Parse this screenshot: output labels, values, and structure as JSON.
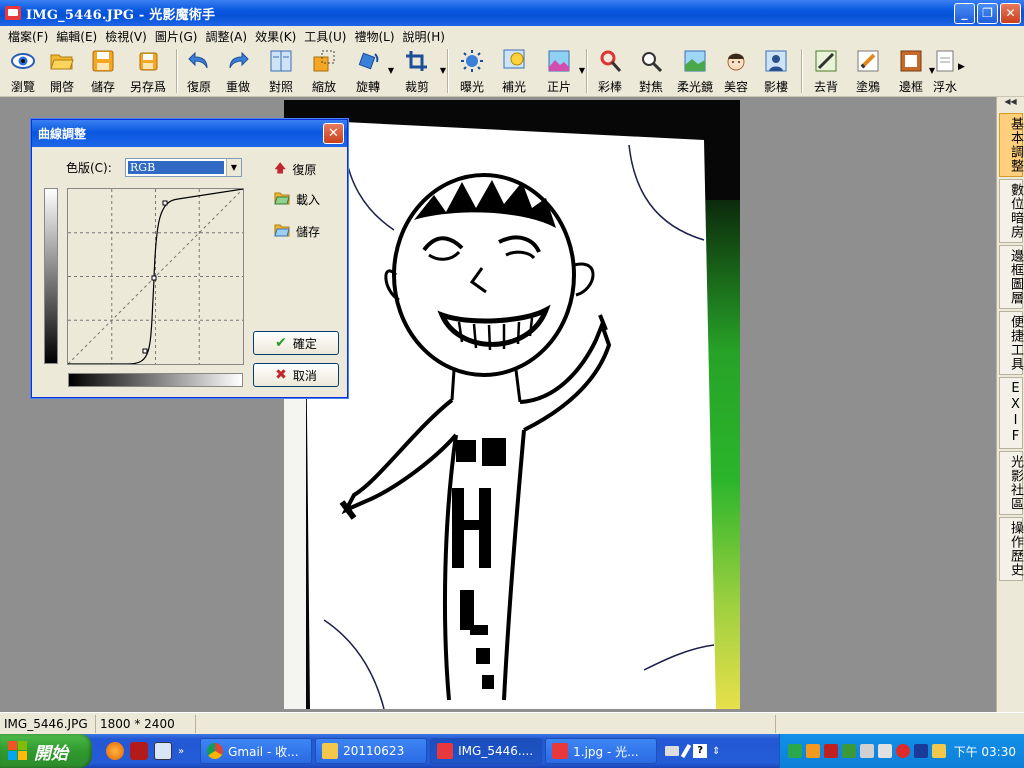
{
  "window": {
    "title": "IMG_5446.JPG - 光影魔術手",
    "min": "_",
    "max": "❐",
    "close": "✕"
  },
  "menu": [
    "檔案(F)",
    "編輯(E)",
    "檢視(V)",
    "圖片(G)",
    "調整(A)",
    "效果(K)",
    "工具(U)",
    "禮物(L)",
    "說明(H)"
  ],
  "toolbar": {
    "browse": "瀏覽",
    "open": "開啓",
    "save": "儲存",
    "save_as": "另存爲",
    "undo": "復原",
    "redo": "重做",
    "compare": "對照",
    "resize": "縮放",
    "rotate": "旋轉",
    "crop": "裁剪",
    "exposure": "曝光",
    "fill_light": "補光",
    "auto_level": "正片",
    "color_pen": "彩棒",
    "focus": "對焦",
    "soft_light": "柔光鏡",
    "beauty": "美容",
    "studio": "影樓",
    "remove_bg": "去背",
    "doodle": "塗鴉",
    "frame": "邊框",
    "watermark": "浮水"
  },
  "dock_tabs": [
    "基本調整",
    "數位暗房",
    "邊框圖層",
    "便捷工具",
    "EXIF",
    "光影社區",
    "操作歷史"
  ],
  "status": {
    "filename": "IMG_5446.JPG",
    "dimensions": "1800 * 2400"
  },
  "dialog": {
    "title": "曲線調整",
    "channel_label": "色版(C):",
    "channel_value": "RGB",
    "reset": "復原",
    "load": "載入",
    "save": "儲存",
    "ok": "確定",
    "cancel": "取消"
  },
  "taskbar": {
    "start": "開始",
    "tasks": [
      "Gmail - 收...",
      "20110623",
      "IMG_5446....",
      "1.jpg - 光..."
    ],
    "clock": "下午 03:30"
  },
  "colors": {
    "title_blue": "#0a58e0",
    "face": "#ece9d8",
    "start_green": "#2f9a2d"
  }
}
